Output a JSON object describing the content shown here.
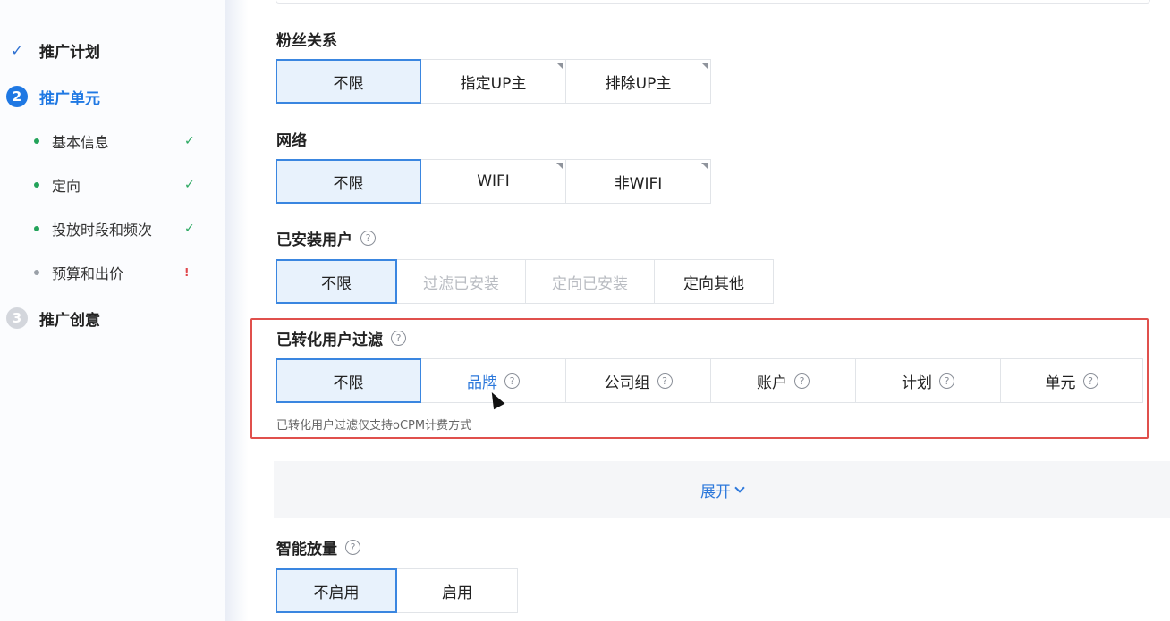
{
  "sidebar": {
    "steps": [
      {
        "label": "推广计划",
        "marker": "✓",
        "state": "done"
      },
      {
        "label": "推广单元",
        "marker": "2",
        "state": "active"
      },
      {
        "label": "推广创意",
        "marker": "3",
        "state": "todo"
      }
    ],
    "substeps": [
      {
        "label": "基本信息",
        "status": "✓"
      },
      {
        "label": "定向",
        "status": "✓"
      },
      {
        "label": "投放时段和频次",
        "status": "✓"
      },
      {
        "label": "预算和出价",
        "status": "!"
      }
    ]
  },
  "form": {
    "fans": {
      "label": "粉丝关系",
      "options": [
        "不限",
        "指定UP主",
        "排除UP主"
      ]
    },
    "network": {
      "label": "网络",
      "options": [
        "不限",
        "WIFI",
        "非WIFI"
      ]
    },
    "installed": {
      "label": "已安装用户",
      "options": [
        "不限",
        "过滤已安装",
        "定向已安装",
        "定向其他"
      ]
    },
    "converted": {
      "label": "已转化用户过滤",
      "options": [
        "不限",
        "品牌",
        "公司组",
        "账户",
        "计划",
        "单元"
      ],
      "hint": "已转化用户过滤仅支持oCPM计费方式"
    },
    "expand_label": "展开",
    "smart": {
      "label": "智能放量",
      "options": [
        "不启用",
        "启用"
      ]
    }
  },
  "icons": {
    "help": "question-circle-icon",
    "check": "check-icon",
    "chevron": "chevron-down-icon",
    "corner": "dropdown-corner-icon"
  },
  "colors": {
    "accent": "#1f78e3",
    "selected_bg": "#e8f2fc",
    "success": "#2aa860",
    "warning": "#e0474c",
    "highlight": "#e0504c"
  }
}
